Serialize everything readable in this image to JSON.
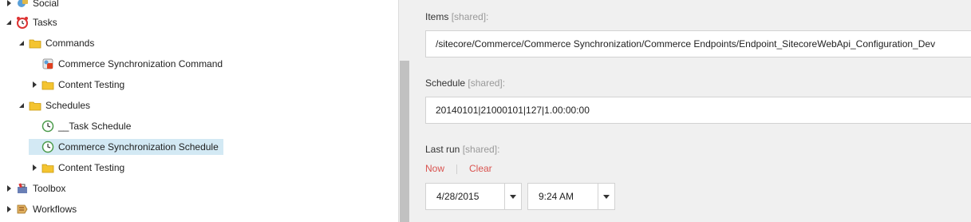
{
  "tree": {
    "nodes": [
      {
        "label": "Social",
        "icon": "social-icon",
        "state": "collapsed"
      },
      {
        "label": "Tasks",
        "icon": "tasks-alarm-clock-icon",
        "state": "expanded"
      },
      {
        "label": "Commands",
        "icon": "folder-icon",
        "state": "expanded"
      },
      {
        "label": "Commerce Synchronization Command",
        "icon": "command-icon",
        "state": "leaf"
      },
      {
        "label": "Content Testing",
        "icon": "folder-icon",
        "state": "collapsed"
      },
      {
        "label": "Schedules",
        "icon": "folder-icon",
        "state": "expanded"
      },
      {
        "label": "__Task Schedule",
        "icon": "schedule-icon",
        "state": "leaf"
      },
      {
        "label": "Commerce Synchronization Schedule",
        "icon": "schedule-icon",
        "state": "leaf",
        "selected": true
      },
      {
        "label": "Content Testing",
        "icon": "folder-icon",
        "state": "collapsed"
      },
      {
        "label": "Toolbox",
        "icon": "toolbox-icon",
        "state": "collapsed"
      },
      {
        "label": "Workflows",
        "icon": "workflows-icon",
        "state": "collapsed"
      }
    ]
  },
  "editor": {
    "items": {
      "label": "Items",
      "shared": "[shared]:",
      "value": "/sitecore/Commerce/Commerce Synchronization/Commerce Endpoints/Endpoint_SitecoreWebApi_Configuration_Dev"
    },
    "schedule": {
      "label": "Schedule",
      "shared": "[shared]:",
      "value": "20140101|21000101|127|1.00:00:00"
    },
    "last_run": {
      "label": "Last run",
      "shared": "[shared]:",
      "now_label": "Now",
      "clear_label": "Clear",
      "date": "4/28/2015",
      "time": "9:24 AM"
    }
  },
  "colors": {
    "selected_row": "#d3e9f4",
    "link_red": "#d9534f",
    "editor_bg": "#f0f0f0"
  }
}
